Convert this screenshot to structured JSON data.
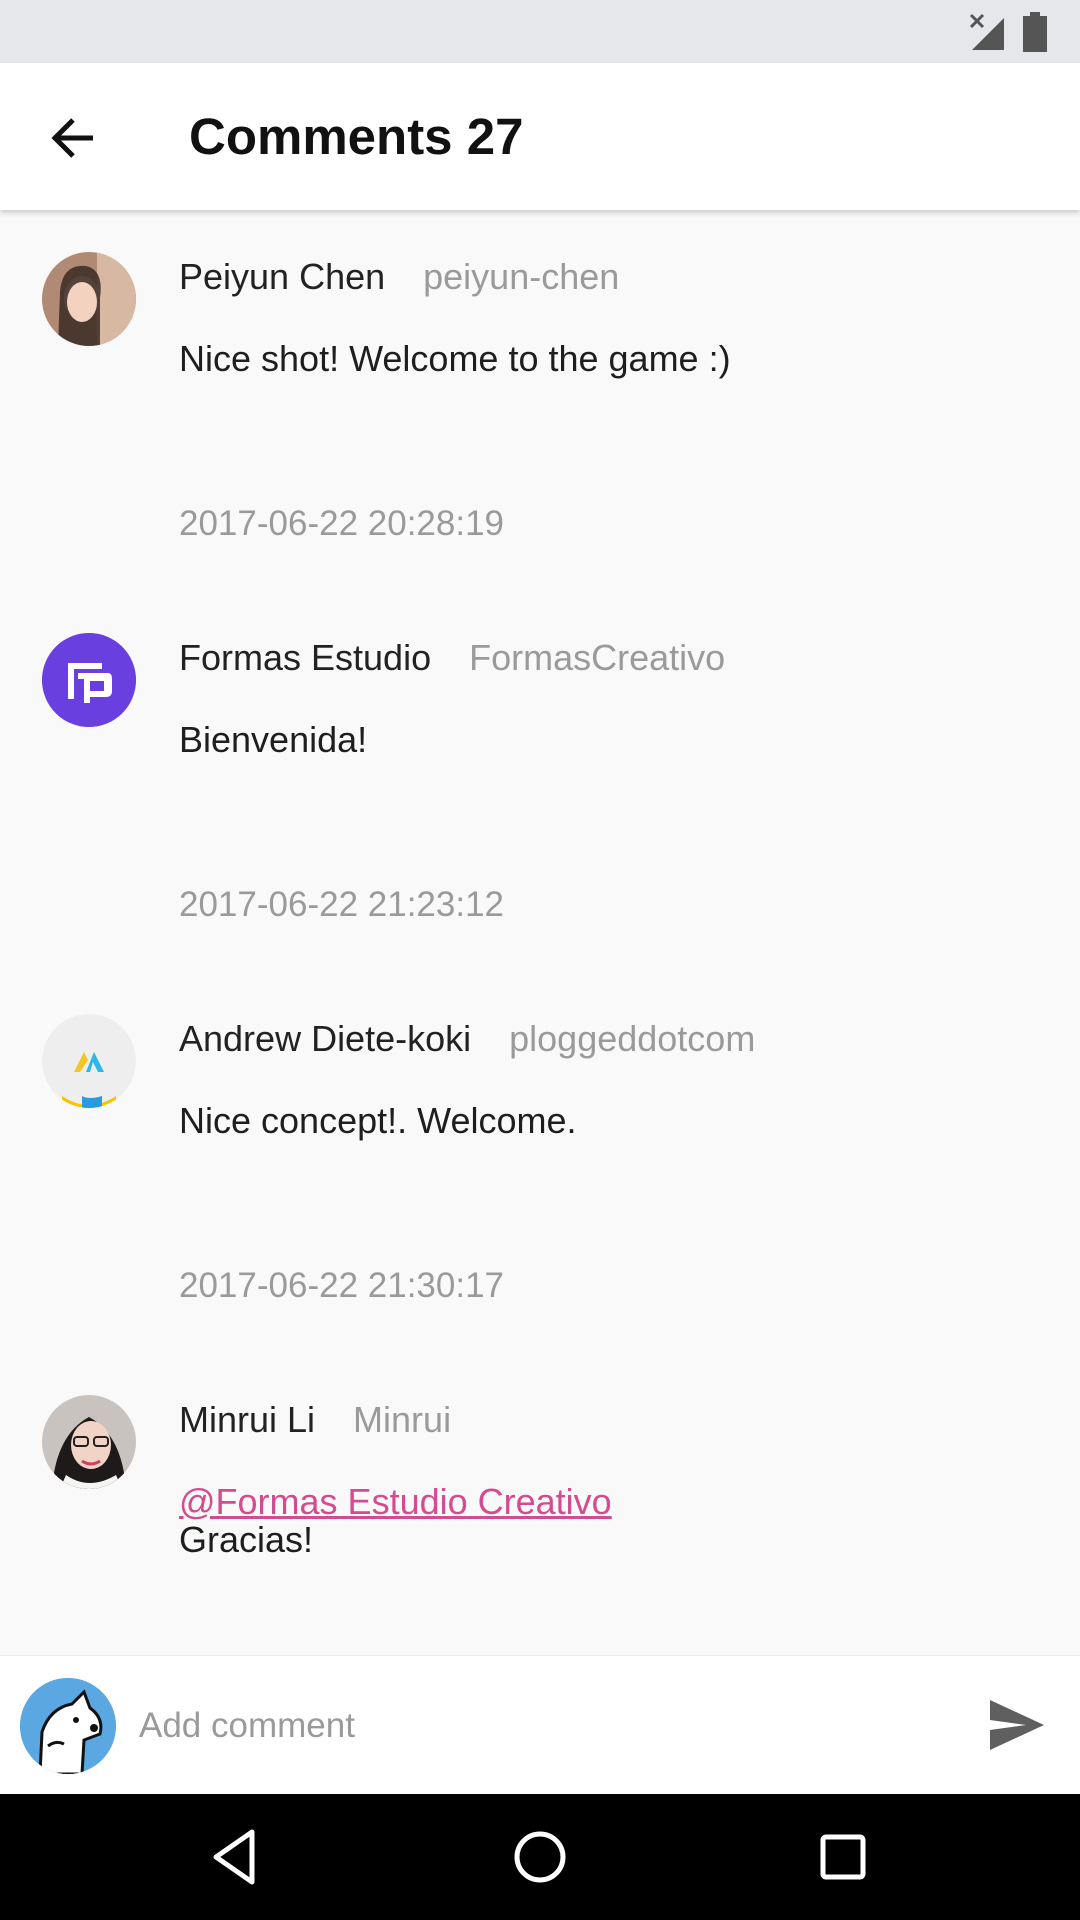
{
  "header": {
    "title": "Comments 27"
  },
  "comments": [
    {
      "name": "Peiyun Chen",
      "username": "peiyun-chen",
      "text": "Nice shot! Welcome to the game :)",
      "time": "2017-06-22 20:28:19"
    },
    {
      "name": "Formas Estudio",
      "username": "FormasCreativo",
      "text": "Bienvenida!",
      "time": "2017-06-22 21:23:12"
    },
    {
      "name": "Andrew Diete-koki",
      "username": "ploggeddotcom",
      "text": "Nice concept!. Welcome.",
      "time": "2017-06-22 21:30:17"
    },
    {
      "name": "Minrui Li",
      "username": "Minrui",
      "mention": "@Formas Estudio Creativo",
      "text": "Gracias!"
    }
  ],
  "composer": {
    "placeholder": "Add comment"
  },
  "colors": {
    "accent_link": "#d44b8f",
    "formas_avatar": "#6a3fe0",
    "muted_text": "#9a9a9a"
  },
  "icons": {
    "back": "arrow-left-icon",
    "send": "send-icon",
    "signal": "signal-icon",
    "battery": "battery-icon",
    "nav_back": "nav-back-icon",
    "nav_home": "nav-home-icon",
    "nav_recents": "nav-recents-icon"
  }
}
